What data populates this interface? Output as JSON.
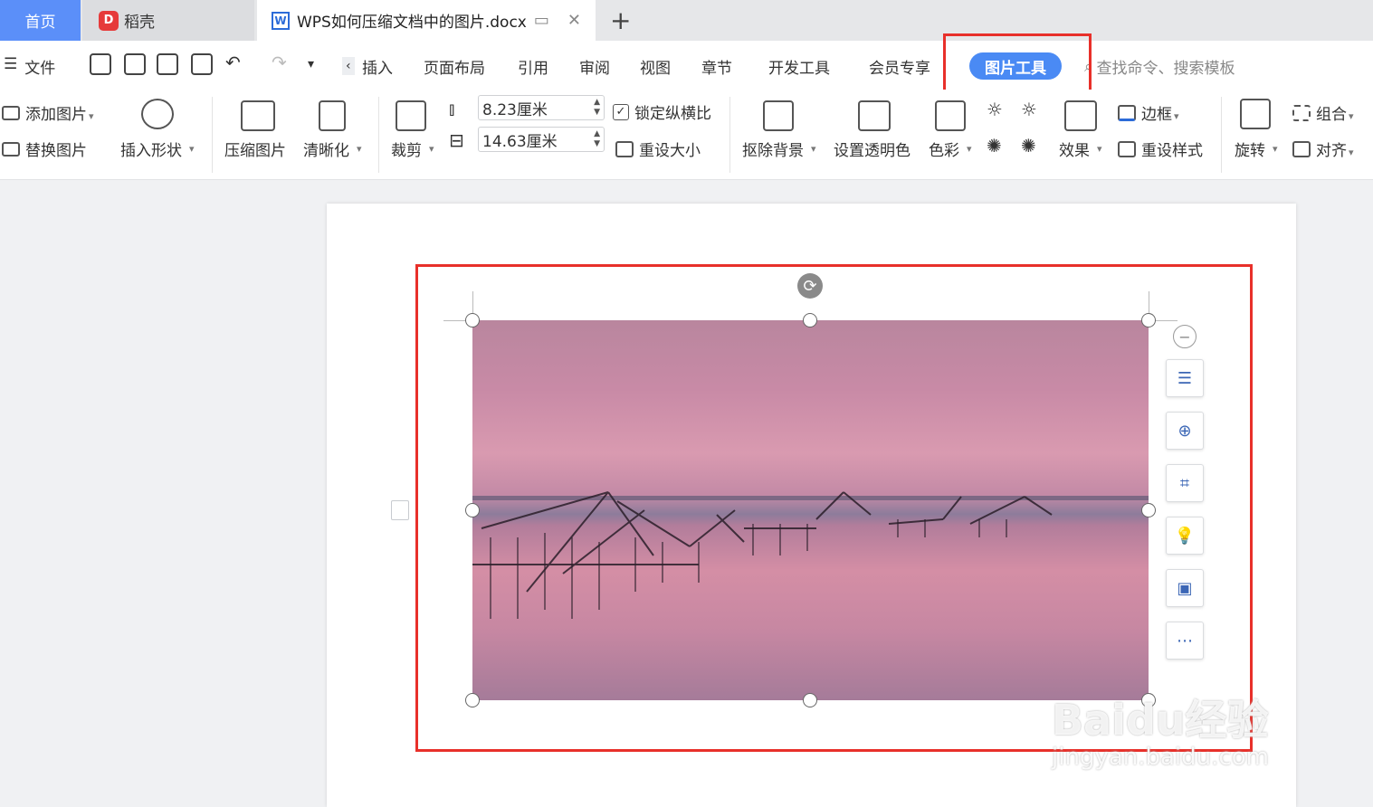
{
  "tabs": {
    "home": "首页",
    "daoke": "稻壳",
    "doc": "WPS如何压缩文档中的图片.docx",
    "new_tab": "+"
  },
  "menu": {
    "file": "文件",
    "items": [
      "插入",
      "页面布局",
      "引用",
      "审阅",
      "视图",
      "章节",
      "开发工具",
      "会员专享"
    ],
    "active_tab": "图片工具",
    "search_placeholder": "查找命令、搜索模板"
  },
  "ribbon": {
    "add_picture": "添加图片",
    "replace_picture": "替换图片",
    "insert_shape": "插入形状",
    "compress_picture": "压缩图片",
    "sharpen": "清晰化",
    "crop": "裁剪",
    "height_value": "8.23厘米",
    "width_value": "14.63厘米",
    "lock_ratio": "锁定纵横比",
    "reset_size": "重设大小",
    "remove_background": "抠除背景",
    "set_transparent": "设置透明色",
    "color": "色彩",
    "effects": "效果",
    "border": "边框",
    "reset_style": "重设样式",
    "rotate": "旋转",
    "group": "组合",
    "align": "对齐"
  },
  "colors": {
    "accent": "#4a8af4",
    "highlight_red": "#e8302a",
    "home_tab": "#5b8ff9"
  },
  "watermark": {
    "brand": "Baidu经验",
    "url": "jingyan.baidu.com"
  }
}
